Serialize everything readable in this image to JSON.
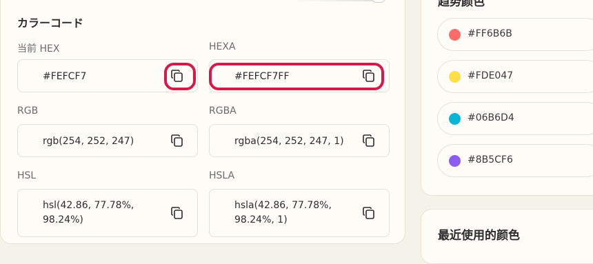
{
  "color_codes": {
    "title": "カラーコード",
    "fields": [
      {
        "label": "当前 HEX",
        "value": "#FEFCF7"
      },
      {
        "label": "HEXA",
        "value": "#FEFCF7FF"
      },
      {
        "label": "RGB",
        "value": "rgb(254, 252, 247)"
      },
      {
        "label": "RGBA",
        "value": "rgba(254, 252, 247, 1)"
      },
      {
        "label": "HSL",
        "value": "hsl(42.86, 77.78%, 98.24%)"
      },
      {
        "label": "HSLA",
        "value": "hsla(42.86, 77.78%, 98.24%, 1)"
      }
    ]
  },
  "trending": {
    "title": "趋势颜色",
    "colors": [
      {
        "hex": "#FF6B6B",
        "label": "#FF6B6B"
      },
      {
        "hex": "#FDE047",
        "label": "#FDE047"
      },
      {
        "hex": "#06B6D4",
        "label": "#06B6D4"
      },
      {
        "hex": "#8B5CF6",
        "label": "#8B5CF6"
      }
    ]
  },
  "recent": {
    "title": "最近使用的颜色"
  },
  "highlight_color": "#D6184B"
}
